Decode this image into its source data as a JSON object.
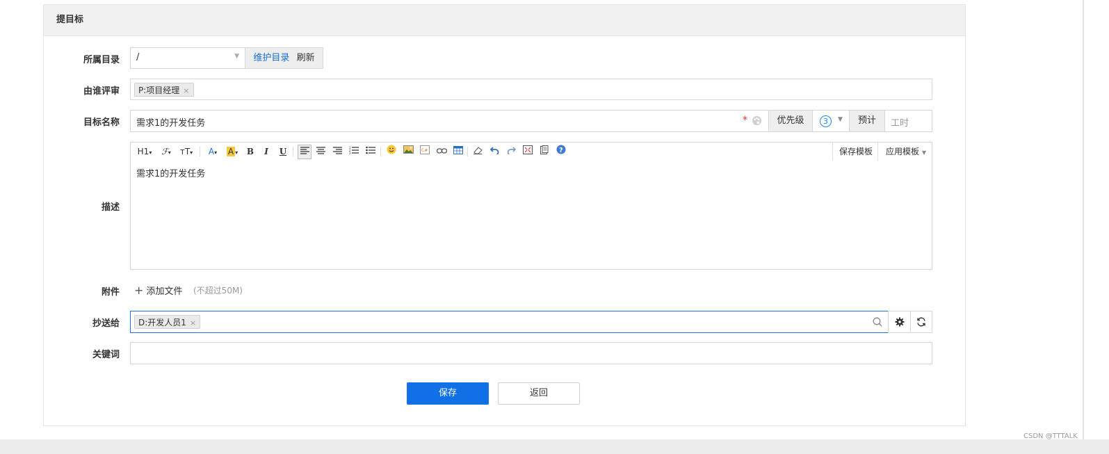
{
  "panel": {
    "title": "提目标"
  },
  "directory": {
    "label": "所属目录",
    "value": "/",
    "maintain_label": "维护目录",
    "refresh_label": "刷新"
  },
  "reviewer": {
    "label": "由谁评审",
    "tags": [
      "P:项目经理"
    ]
  },
  "goal_name": {
    "label": "目标名称",
    "value": "需求1的开发任务",
    "required_mark": "*",
    "priority_label": "优先级",
    "priority_value": "3",
    "estimate_label": "预计",
    "hours_placeholder": "工时"
  },
  "description": {
    "label": "描述",
    "content": "需求1的开发任务",
    "toolbar": {
      "heading": "H1",
      "font": "ℱ",
      "font_size": "ᴛT",
      "font_color": "A",
      "bg_color": "A",
      "bold": "B",
      "italic": "I",
      "underline": "U",
      "save_template": "保存模板",
      "apply_template": "应用模板"
    }
  },
  "attachment": {
    "label": "附件",
    "add_label": "添加文件",
    "hint": "(不超过50M)"
  },
  "cc": {
    "label": "抄送给",
    "tags": [
      "D:开发人员1"
    ]
  },
  "keywords": {
    "label": "关键词",
    "value": ""
  },
  "actions": {
    "save_label": "保存",
    "back_label": "返回"
  },
  "watermark": "CSDN @TTTALK",
  "colors": {
    "primary": "#1170e6",
    "link": "#1a6fd6",
    "focus_border": "#1a73e8",
    "required": "#e53333",
    "priority_circle": "#1e88e5"
  }
}
